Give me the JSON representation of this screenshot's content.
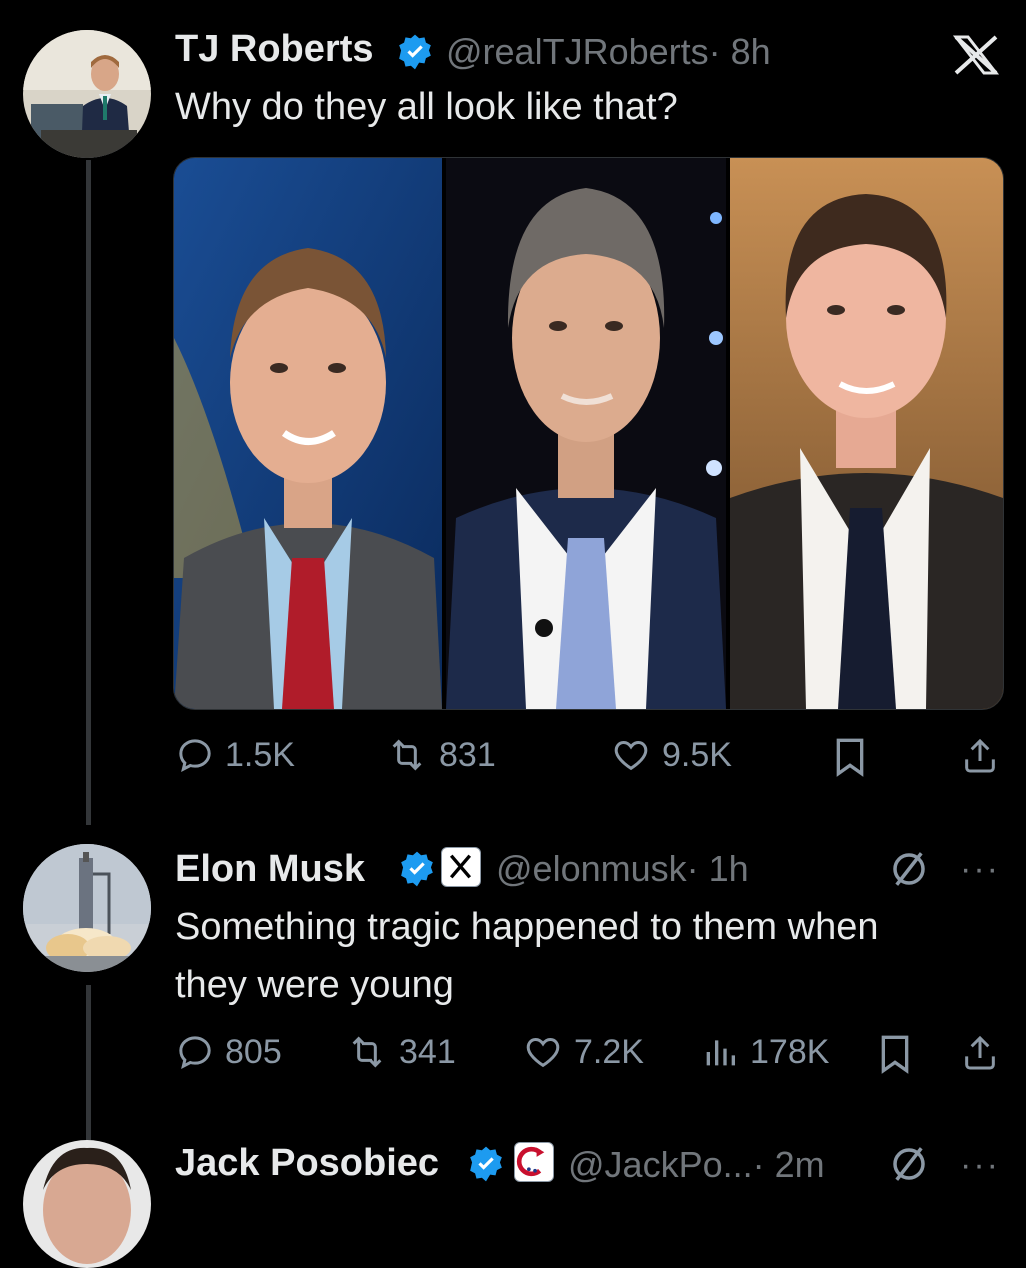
{
  "tweets": [
    {
      "name": "TJ Roberts",
      "handle": "@realTJRoberts",
      "time": "· 8h",
      "text": "Why do they all look like that?",
      "stats": {
        "replies": "1.5K",
        "reposts": "831",
        "likes": "9.5K"
      },
      "avatar_icon": "person-at-desk-avatar"
    },
    {
      "name": "Elon Musk",
      "handle": "@elonmusk",
      "time": "· 1h",
      "text": "Something tragic happened to them when they were young",
      "stats": {
        "replies": "805",
        "reposts": "341",
        "likes": "7.2K",
        "views": "178K"
      },
      "avatar_icon": "rocket-launch-avatar"
    },
    {
      "name": "Jack Posobiec",
      "handle": "@JackPo...",
      "time": "· 2m",
      "avatar_icon": "person-avatar"
    }
  ],
  "colors": {
    "background": "#000000",
    "verified": "#1d9bf0",
    "muted": "#71767b",
    "text": "#e7e9ea"
  }
}
